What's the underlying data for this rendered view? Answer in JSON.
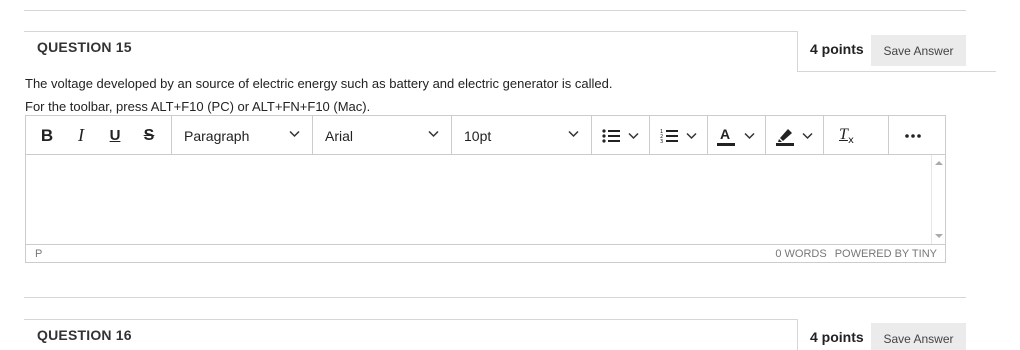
{
  "question15": {
    "title": "QUESTION 15",
    "points": "4 points",
    "save_label": "Save Answer",
    "prompt": "The voltage developed by an source of electric energy such as battery and electric generator is called.",
    "toolbar_hint": "For the toolbar, press ALT+F10 (PC) or ALT+FN+F10 (Mac)."
  },
  "editor": {
    "toolbar": {
      "bold_icon": "bold-icon",
      "italic_icon": "italic-icon",
      "underline_icon": "underline-icon",
      "strikethrough_icon": "strikethrough-icon",
      "block_format": "Paragraph",
      "font_family": "Arial",
      "font_size": "10pt",
      "bullet_list_icon": "bullet-list-icon",
      "numbered_list_icon": "numbered-list-icon",
      "text_color_icon": "text-color-icon",
      "highlight_icon": "highlight-icon",
      "clear_format_icon": "clear-formatting-icon",
      "more_icon": "more-icon"
    },
    "content": "",
    "status": {
      "path": "P",
      "word_count": "0 WORDS",
      "powered_by": "POWERED BY TINY"
    }
  },
  "question16": {
    "title": "QUESTION 16",
    "points": "4 points",
    "save_label": "Save Answer"
  }
}
